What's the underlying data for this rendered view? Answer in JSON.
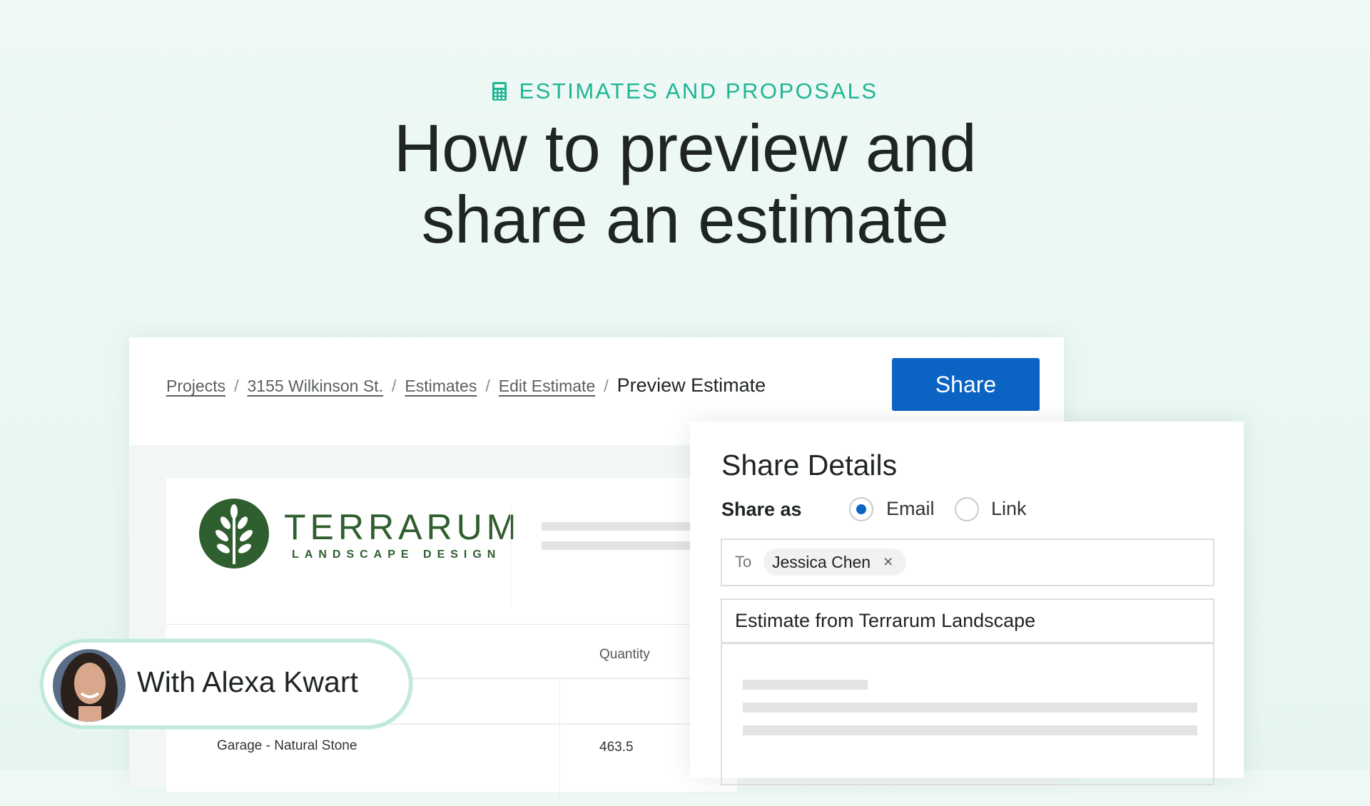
{
  "header": {
    "category": "ESTIMATES AND PROPOSALS",
    "category_icon": "calculator-icon",
    "title_line1": "How to preview and",
    "title_line2": "share an estimate"
  },
  "breadcrumb": {
    "items": [
      "Projects",
      "3155 Wilkinson St.",
      "Estimates",
      "Edit Estimate"
    ],
    "current": "Preview Estimate",
    "separator": "/"
  },
  "share_button": "Share",
  "document": {
    "logo_name": "TERRARUM",
    "logo_tagline": "LANDSCAPE DESIGN",
    "column_quantity": "Quantity",
    "row_item": "Garage - Natural Stone",
    "row_quantity": "463.5"
  },
  "share_panel": {
    "title": "Share Details",
    "share_as_label": "Share as",
    "options": [
      "Email",
      "Link"
    ],
    "selected": "Email",
    "to_label": "To",
    "recipient": "Jessica Chen",
    "remove_icon": "×",
    "subject": "Estimate from Terrarum Landscape"
  },
  "presenter": {
    "label": "With Alexa Kwart"
  },
  "colors": {
    "accent": "#1fb594",
    "button": "#0b63c4",
    "logo_green": "#2f5e2f",
    "background": "#eaf7f2"
  }
}
